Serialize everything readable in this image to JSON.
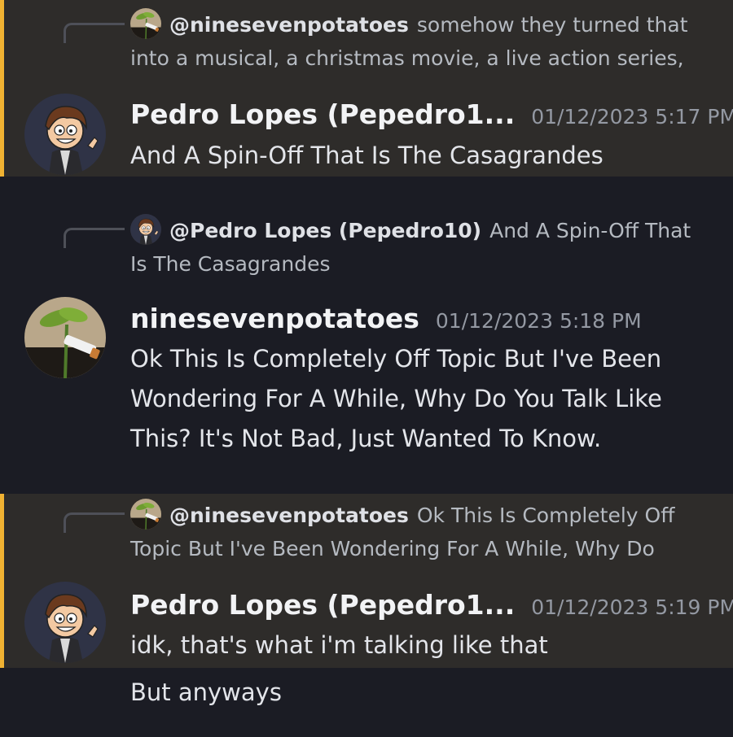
{
  "messages": [
    {
      "reply": {
        "author": "@ninesevenpotatoes",
        "text": "somehow they turned that into a musical, a christmas movie, a live action series,"
      },
      "author": "Pedro Lopes (Pepedro1...",
      "timestamp": "01/12/2023 5:17 PM",
      "lines": [
        "And A Spin-Off That Is The Casagrandes"
      ]
    },
    {
      "reply": {
        "author": "@Pedro Lopes (Pepedro10)",
        "text": "And A Spin-Off That Is The Casagrandes"
      },
      "author": "ninesevenpotatoes",
      "timestamp": "01/12/2023 5:18 PM",
      "lines": [
        "Ok This Is Completely Off Topic But I've Been Wondering For A While, Why Do You Talk Like This? It's Not Bad, Just Wanted To Know."
      ]
    },
    {
      "reply": {
        "author": "@ninesevenpotatoes",
        "text": "Ok This Is Completely Off Topic But I've Been Wondering For A While, Why Do"
      },
      "author": "Pedro Lopes (Pepedro1...",
      "timestamp": "01/12/2023 5:19 PM",
      "lines": [
        "idk, that's what i'm talking like that",
        "But anyways"
      ]
    }
  ],
  "colors": {
    "background": "#1b1c24",
    "highlight_background": "#2e2c2a",
    "highlight_bar": "#f0b232",
    "username": "#f2f3f5",
    "timestamp": "#9499a3",
    "reply_text": "#b5bac1"
  },
  "icons": {
    "pedro_avatar": "cartoon-boy-avatar-icon",
    "ninesevenpotatoes_avatar": "potato-plant-avatar-icon"
  }
}
